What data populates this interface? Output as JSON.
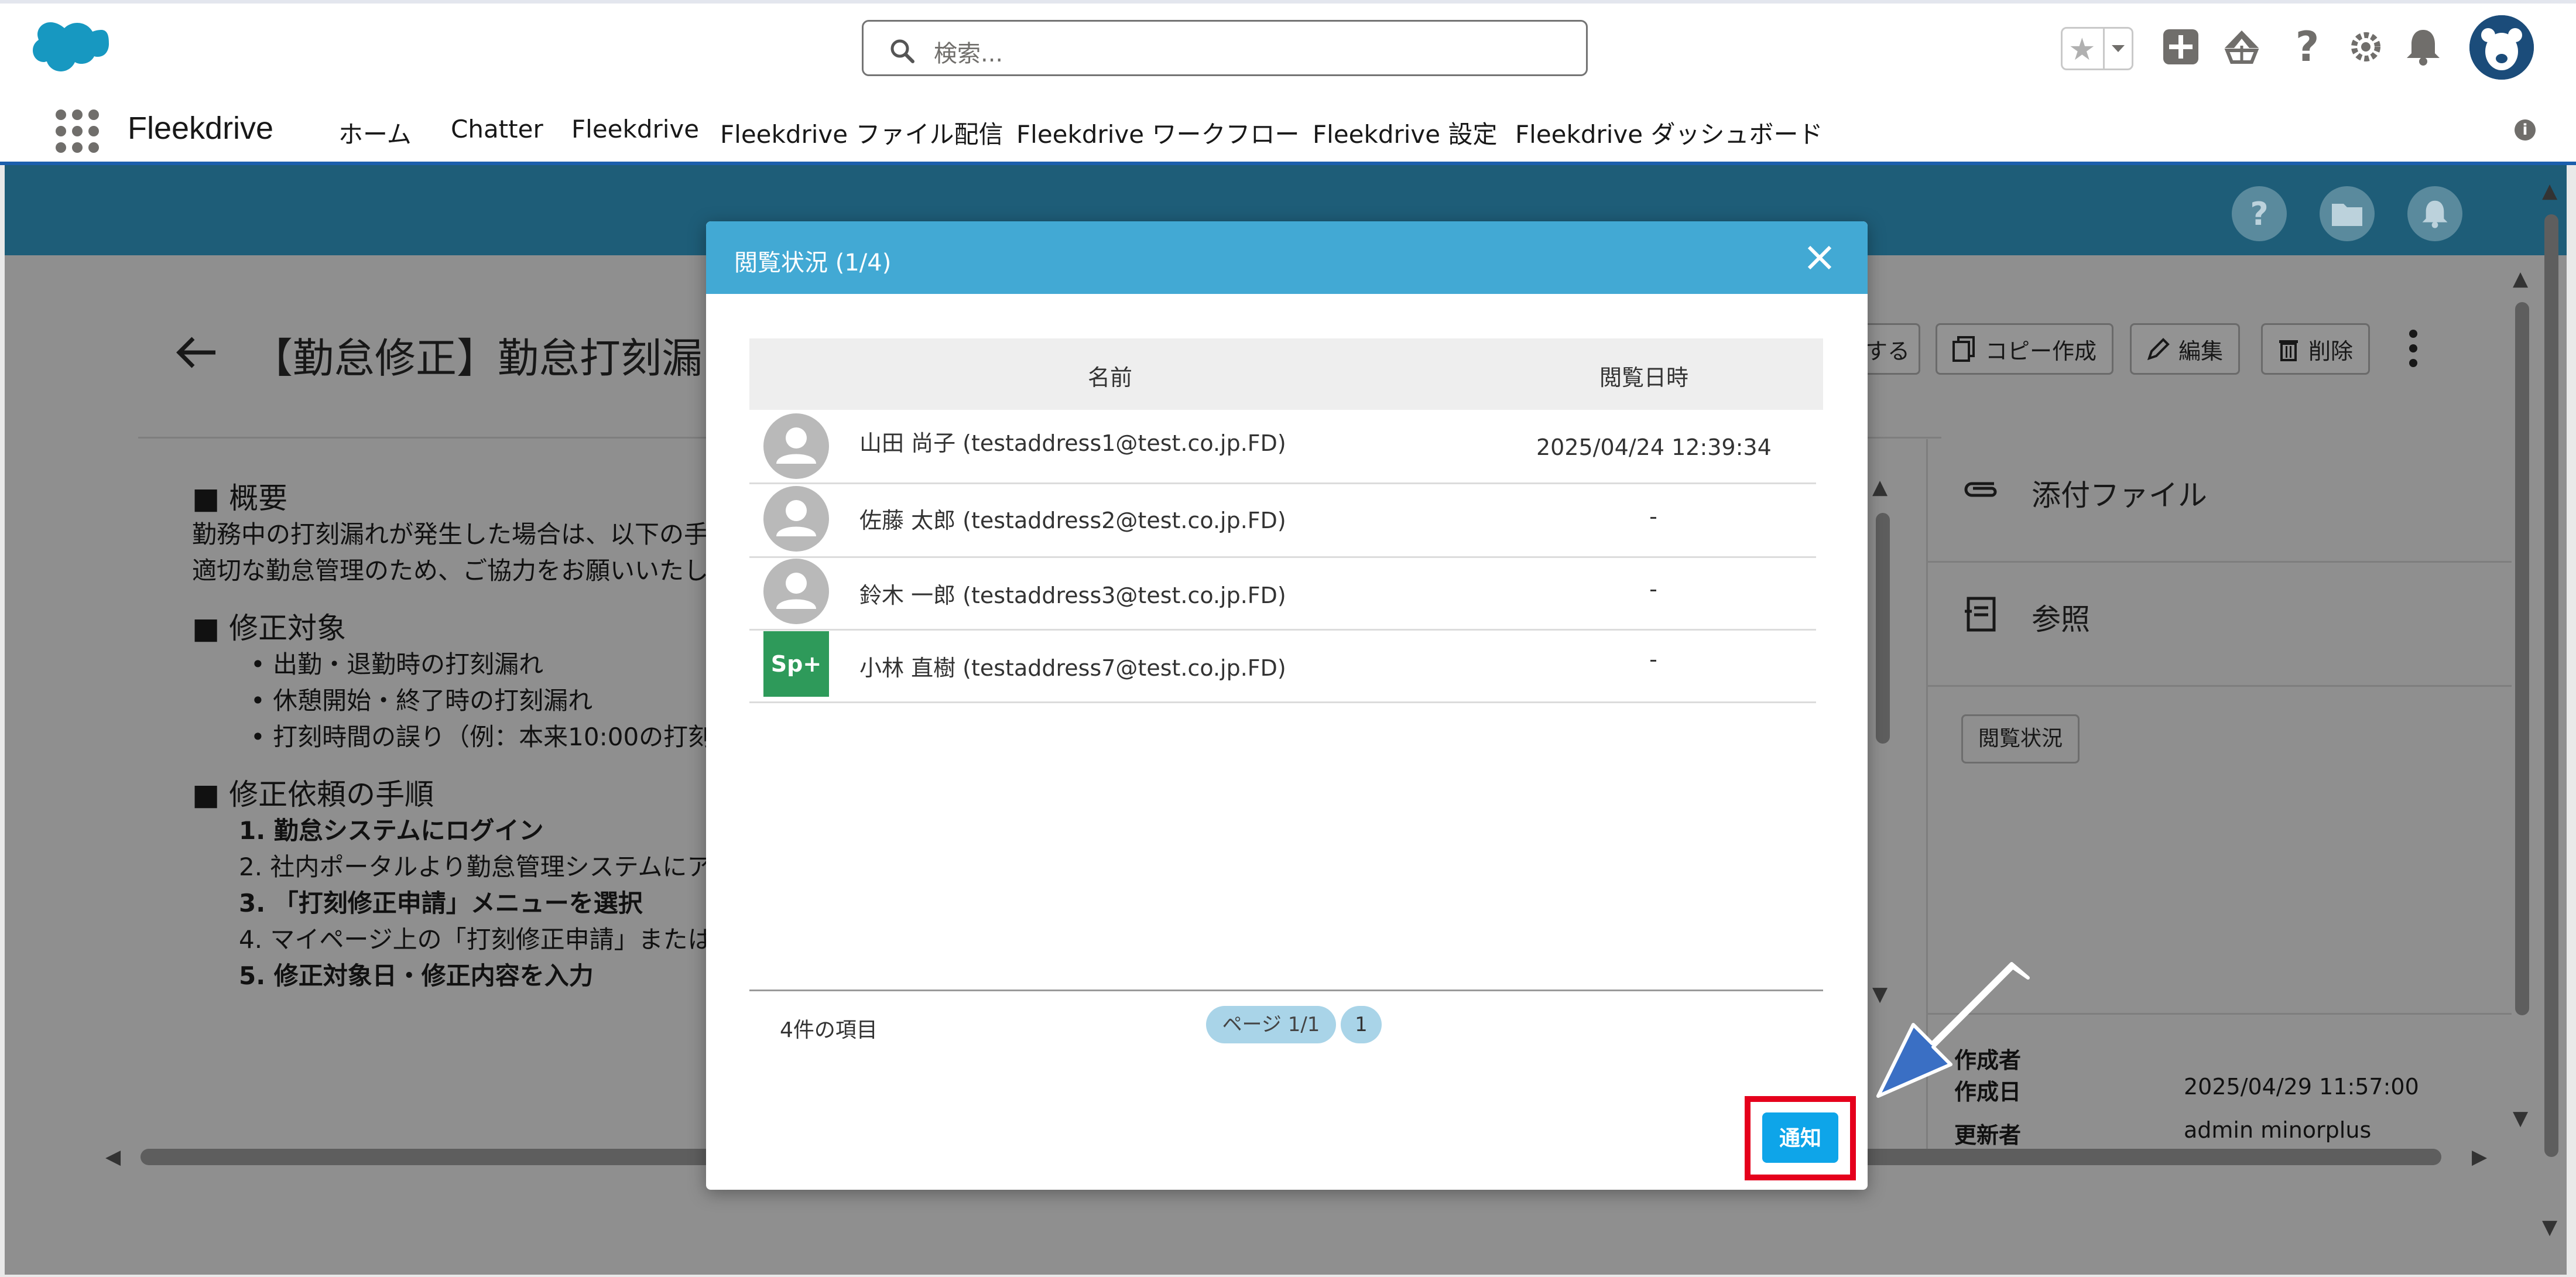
{
  "global_header": {
    "search_placeholder": "検索...",
    "icons": [
      "salesforce-logo",
      "favorites-star-icon",
      "chevron-down-icon",
      "add-icon",
      "trailhead-icon",
      "help-icon",
      "settings-icon",
      "bell-icon",
      "avatar-icon"
    ]
  },
  "nav": {
    "app_name": "Fleekdrive",
    "tabs": [
      "ホーム",
      "Chatter",
      "Fleekdrive",
      "Fleekdrive ファイル配信",
      "Fleekdrive ワークフロー",
      "Fleekdrive 設定",
      "Fleekdrive ダッシュボード"
    ]
  },
  "record": {
    "title": "【勤怠修正】勤怠打刻漏",
    "actions": [
      "する",
      "コピー作成",
      "編集",
      "削除"
    ],
    "body": {
      "sec1_title": "■ 概要",
      "sec1_line1": "勤務中の打刻漏れが発生した場合は、以下の手",
      "sec1_line2": "適切な勤怠管理のため、ご協力をお願いいたし",
      "sec2_title": "■ 修正対象",
      "sec2_items": [
        "• 出勤・退勤時の打刻漏れ",
        "• 休憩開始・終了時の打刻漏れ",
        "• 打刻時間の誤り（例：本来10:00の打刻"
      ],
      "sec3_title": "■ 修正依頼の手順",
      "sec3_items": [
        "1. 勤怠システムにログイン",
        "2. 社内ポータルより勤怠管理システムにア",
        "3. 「打刻修正申請」メニューを選択",
        "4. マイページ上の「打刻修正申請」または",
        "5. 修正対象日・修正内容を入力"
      ]
    },
    "right_panel": {
      "attachments": "添付ファイル",
      "references": "参照",
      "view_status_button": "閲覧状況",
      "created_by_label": "作成者",
      "created_date_label": "作成日",
      "created_date": "2025/04/29 11:57:00",
      "updated_by_label": "更新者",
      "updated_by": "admin minorplus"
    }
  },
  "modal": {
    "title": "閲覧状況 (1/4)",
    "columns": [
      "名前",
      "閲覧日時"
    ],
    "rows": [
      {
        "name": "山田 尚子 (testaddress1@test.co.jp.FD)",
        "viewed": "2025/04/24 12:39:34",
        "avatar": "person-icon"
      },
      {
        "name": "佐藤 太郎 (testaddress2@test.co.jp.FD)",
        "viewed": "-",
        "avatar": "person-icon"
      },
      {
        "name": "鈴木 一郎 (testaddress3@test.co.jp.FD)",
        "viewed": "-",
        "avatar": "person-icon"
      },
      {
        "name": "小林 直樹 (testaddress7@test.co.jp.FD)",
        "viewed": "-",
        "avatar": "Sp+"
      }
    ],
    "item_count": "4件の項目",
    "page_label": "ページ 1/1",
    "page_number": "1",
    "notify_button": "通知"
  },
  "colors": {
    "modal_header": "#42a9d4",
    "notify_button": "#0ea5e9",
    "highlight": "#e5001c",
    "arrow": "#3a6fc4",
    "nav_underline": "#1b5fad"
  }
}
